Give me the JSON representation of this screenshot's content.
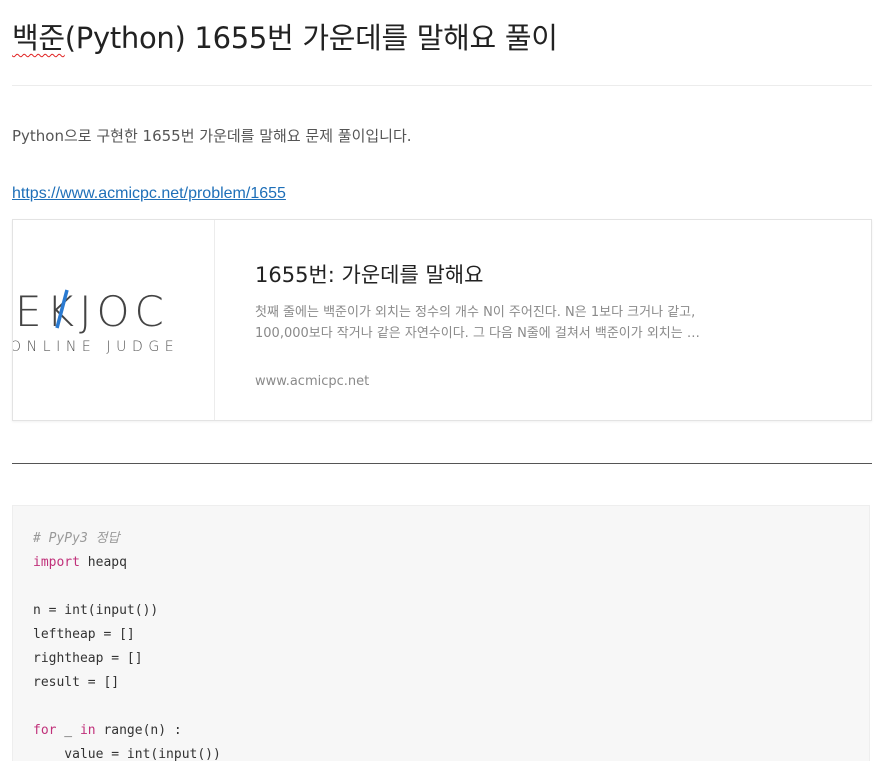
{
  "post": {
    "title_prefix": "백준",
    "title_rest": "(Python) 1655번 가운데를 말해요 풀이",
    "intro": "Python으로 구현한 1655번 가운데를 말해요 문제 풀이입니다.",
    "link": "https://www.acmicpc.net/problem/1655"
  },
  "card": {
    "logo_main": "EKJOC",
    "logo_sub": "ONLINE JUDGE",
    "title": "1655번: 가운데를 말해요",
    "desc": "첫째 줄에는 백준이가 외치는 정수의 개수 N이 주어진다. N은 1보다 크거나 같고, 100,000보다 작거나 같은 자연수이다. 그 다음 N줄에 걸쳐서 백준이가 외치는 …",
    "domain": "www.acmicpc.net"
  },
  "code": {
    "comment": "# PyPy3 정답",
    "kw_import": "import",
    "import_rest": " heapq",
    "line_n": "n = int(input())",
    "line_left": "leftheap = []",
    "line_right": "rightheap = []",
    "line_result": "result = []",
    "kw_for": "for",
    "for_mid": " _ ",
    "kw_in": "in",
    "for_rest": " range(n) :",
    "line_value": "    value = int(input())"
  }
}
